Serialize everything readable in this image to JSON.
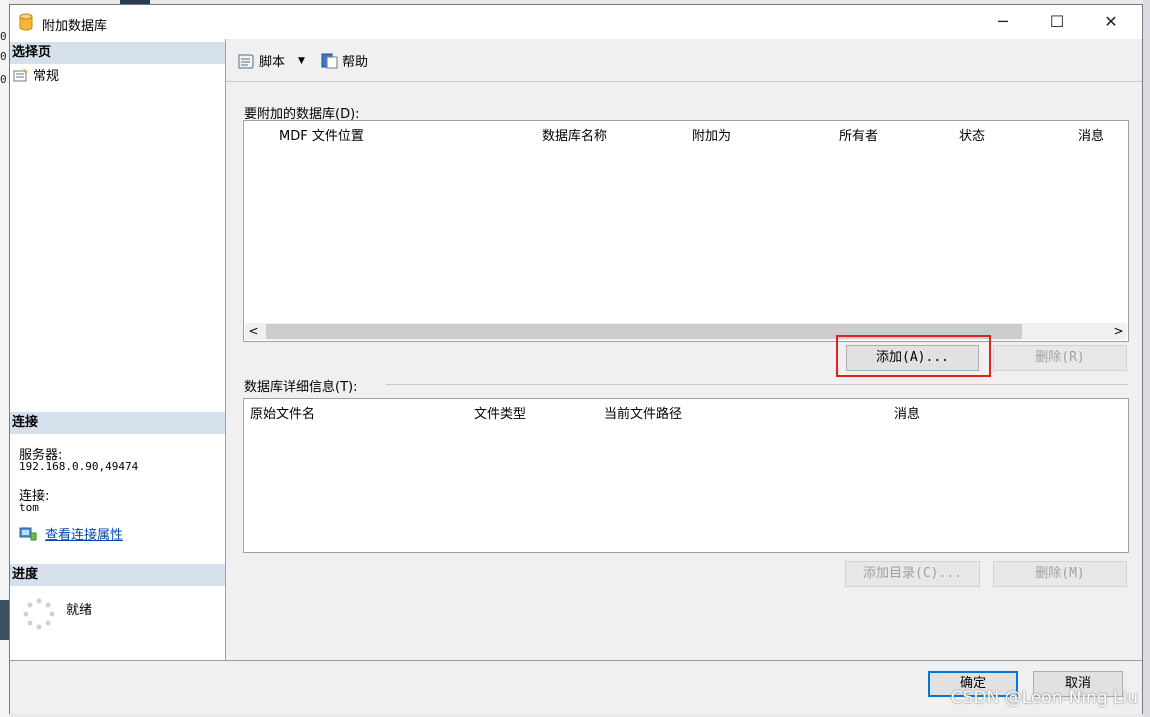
{
  "window": {
    "title": "附加数据库",
    "min_icon": "minimize-icon",
    "max_icon": "maximize-icon",
    "close_icon": "close-icon"
  },
  "background": {
    "numbers": [
      "0",
      "0",
      "0"
    ]
  },
  "sidebar": {
    "select_page_header": "选择页",
    "pages": [
      {
        "label": "常规",
        "icon": "general-page-icon"
      }
    ],
    "connection_header": "连接",
    "server_label": "服务器:",
    "server_value": "192.168.0.90,49474",
    "connection_label": "连接:",
    "connection_value": "tom",
    "view_props_link": "查看连接属性",
    "progress_header": "进度",
    "progress_status": "就绪"
  },
  "toolbar": {
    "script_label": "脚本",
    "help_label": "帮助",
    "dropdown_icon": "chevron-down-icon"
  },
  "attach_section": {
    "label": "要附加的数据库(D):",
    "columns": [
      "MDF 文件位置",
      "数据库名称",
      "附加为",
      "所有者",
      "状态",
      "消息"
    ],
    "rows": [],
    "add_button": "添加(A)...",
    "remove_button": "删除(R)"
  },
  "details_section": {
    "label": "数据库详细信息(T):",
    "columns": [
      "原始文件名",
      "文件类型",
      "当前文件路径",
      "消息"
    ],
    "rows": [],
    "add_catalog_button": "添加目录(C)...",
    "remove_button": "删除(M)"
  },
  "footer": {
    "ok_button": "确定",
    "cancel_button": "取消"
  },
  "watermark": "CSDN @Leon-Ning Liu",
  "colors": {
    "section_header": "#d6e0ec",
    "highlight": "#e0221e",
    "link": "#0645ad",
    "primary_border": "#0078d7"
  }
}
